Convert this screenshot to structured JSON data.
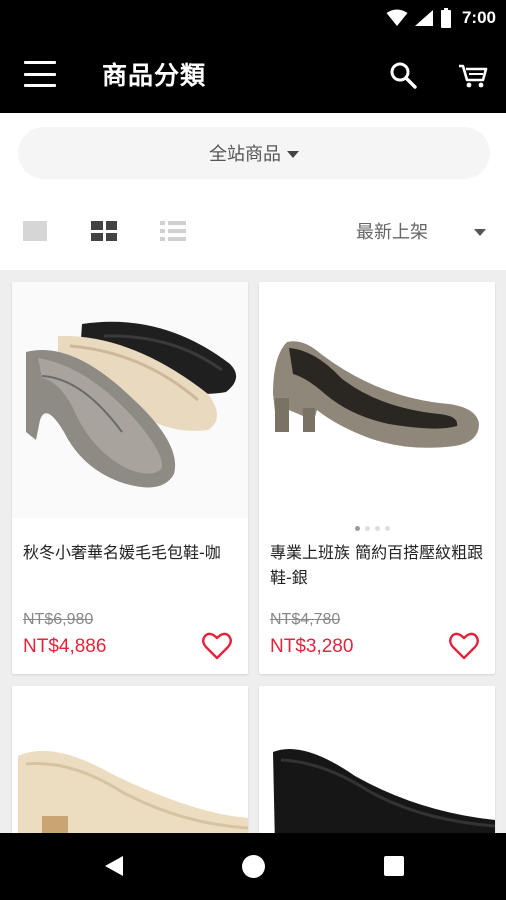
{
  "status_bar": {
    "time": "7:00"
  },
  "app_bar": {
    "title": "商品分類"
  },
  "filters": {
    "category": "全站商品",
    "sort": "最新上架"
  },
  "products": [
    {
      "name": "秋冬小奢華名媛毛毛包鞋-咖",
      "price_original": "NT$6,980",
      "price_sale": "NT$4,886"
    },
    {
      "name": "專業上班族 簡約百搭壓紋粗跟鞋-銀",
      "price_original": "NT$4,780",
      "price_sale": "NT$3,280"
    }
  ],
  "colors": {
    "accent": "#e4243b",
    "bar": "#000000"
  }
}
